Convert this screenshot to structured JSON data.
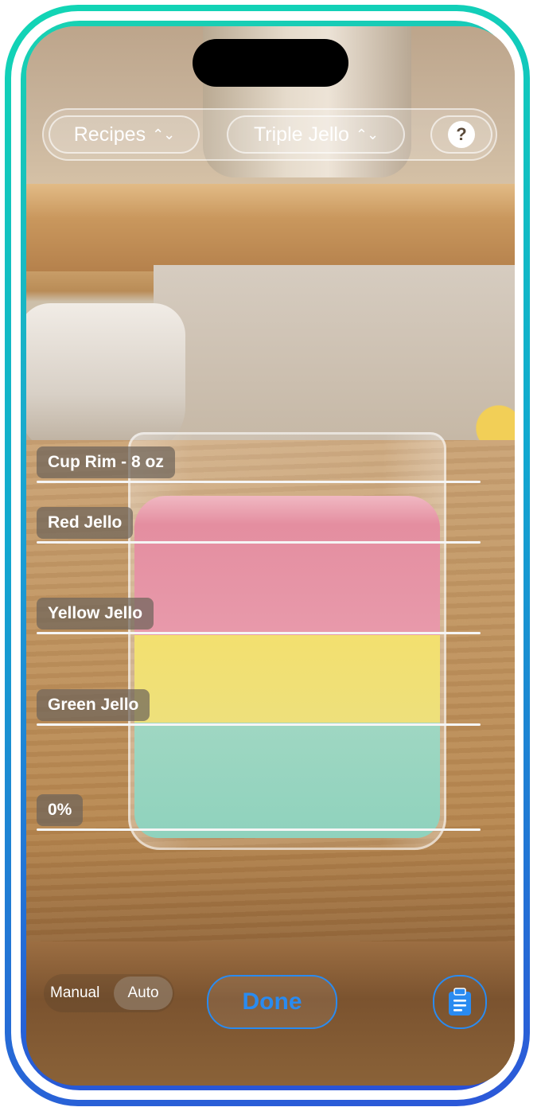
{
  "top_bar": {
    "recipes_label": "Recipes",
    "recipe_selected": "Triple Jello",
    "help_label": "?"
  },
  "markers": [
    {
      "label": "Cup Rim - 8 oz"
    },
    {
      "label": "Red Jello"
    },
    {
      "label": "Yellow Jello"
    },
    {
      "label": "Green Jello"
    },
    {
      "label": "0%"
    }
  ],
  "bottom_bar": {
    "mode_manual": "Manual",
    "mode_auto": "Auto",
    "selected_mode": "Auto",
    "done_label": "Done",
    "clipboard_icon": "clipboard-icon"
  },
  "colors": {
    "accent": "#2a8bf0",
    "frame_gradient_start": "#12d6b4",
    "frame_gradient_end": "#2c57d8"
  }
}
